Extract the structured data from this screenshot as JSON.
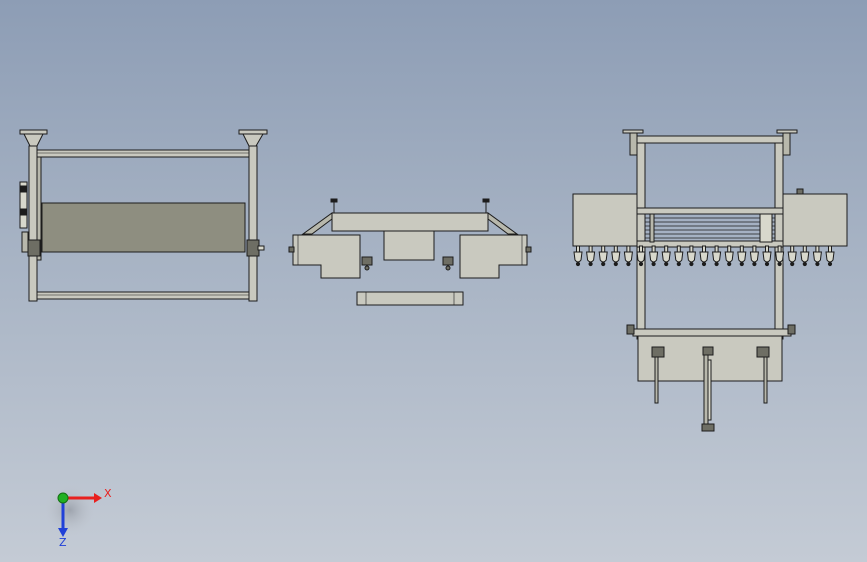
{
  "viewport": {
    "background_top": "#8d9db5",
    "background_bottom": "#c4cbd5"
  },
  "colors": {
    "line": "#1c1c1c",
    "frame_fill": "#c9c9bf",
    "panel_fill": "#8e8e80",
    "light_fill": "#d8d8cc",
    "axis_x": "#e8201e",
    "axis_y": "#22b022",
    "axis_z": "#2040d8"
  },
  "triad": {
    "x_label": "X",
    "z_label": "Z",
    "icons": [
      "x-axis-arrow-icon",
      "y-axis-dot-icon",
      "z-axis-arrow-icon"
    ]
  }
}
